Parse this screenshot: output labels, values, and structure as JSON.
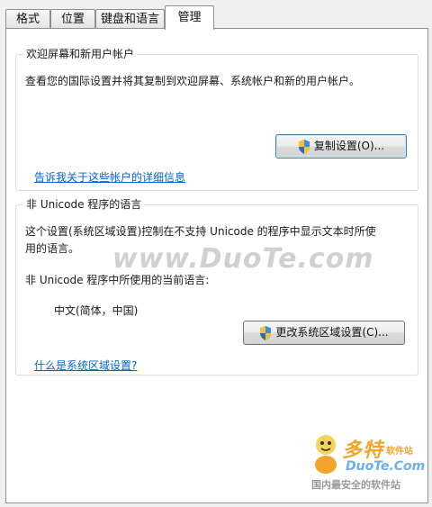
{
  "tabs": [
    {
      "label": "格式"
    },
    {
      "label": "位置"
    },
    {
      "label": "键盘和语言"
    },
    {
      "label": "管理"
    }
  ],
  "welcome_group": {
    "title": "欢迎屏幕和新用户帐户",
    "description": "查看您的国际设置并将其复制到欢迎屏幕、系统帐户和新的用户帐户。",
    "copy_button": "复制设置(O)...",
    "details_link": "告诉我关于这些帐户的详细信息"
  },
  "unicode_group": {
    "title": "非 Unicode 程序的语言",
    "description_line1": "这个设置(系统区域设置)控制在不支持 Unicode 的程序中显示文本时所使",
    "description_line2": "用的语言。",
    "current_label": "非 Unicode 程序中所使用的当前语言:",
    "current_value": "中文(简体，中国)",
    "change_button": "更改系统区域设置(C)...",
    "help_link": "什么是系统区域设置?"
  },
  "watermark": "www.DuoTe.com",
  "logo": {
    "cn": "多特",
    "sub": "软件站",
    "en": "DuoTe.Com",
    "tagline": "国内最安全的软件站"
  },
  "colors": {
    "link": "#0066cc",
    "logo_orange": "#f2a52b",
    "logo_blue": "#6bb0e6"
  }
}
